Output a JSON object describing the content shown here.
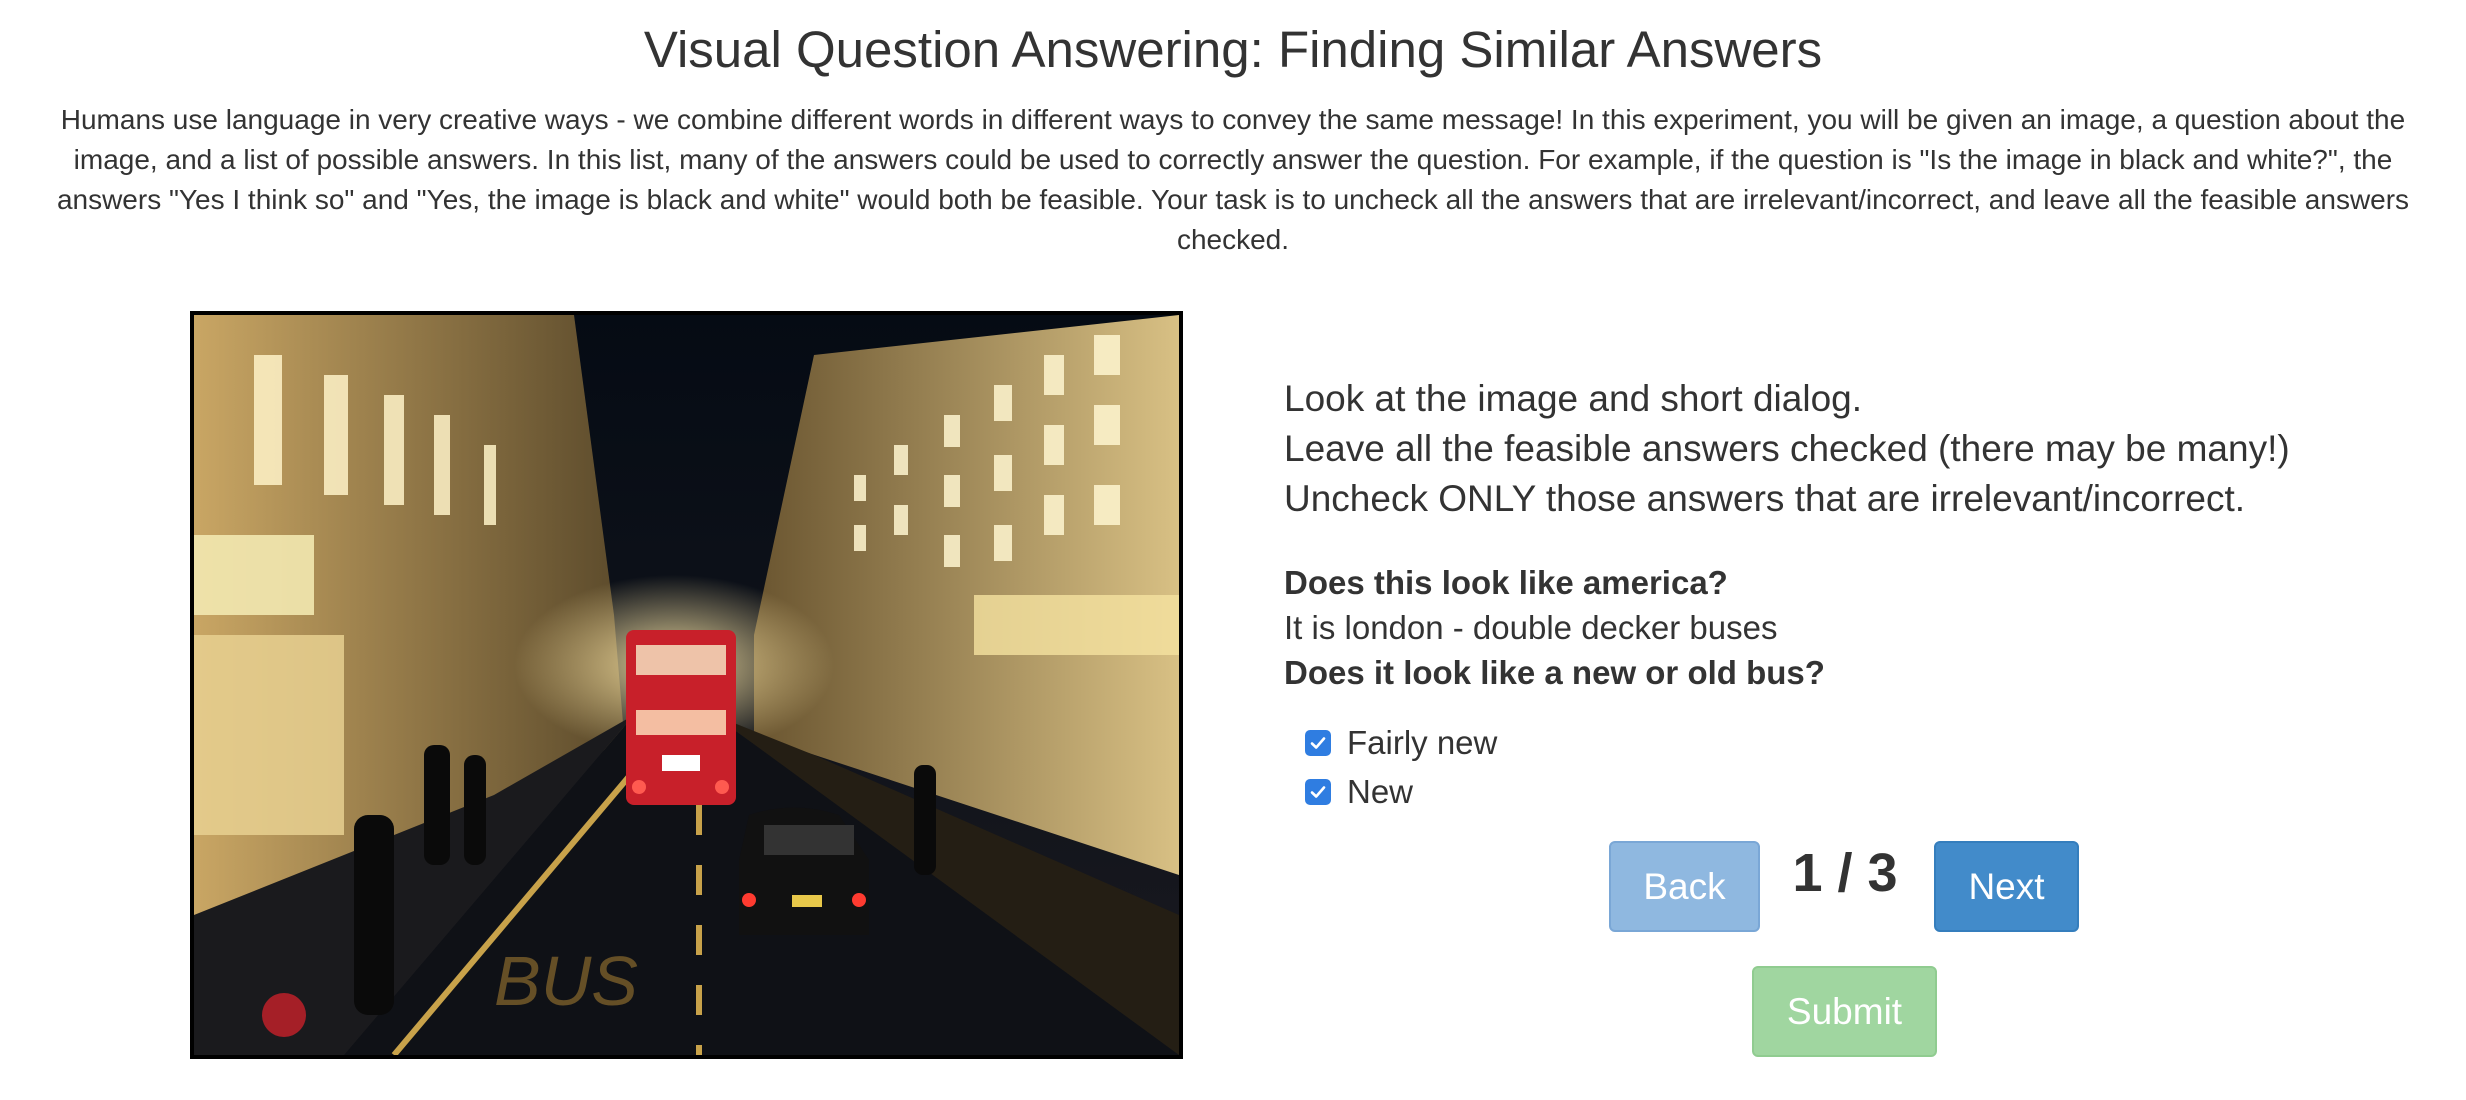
{
  "page": {
    "title": "Visual Question Answering: Finding Similar Answers",
    "intro": "Humans use language in very creative ways - we combine different words in different ways to convey the same message! In this experiment, you will be given an image, a question about the image, and a list of possible answers. In this list, many of the answers could be used to correctly answer the question. For example, if the question is \"Is the image in black and white?\", the answers \"Yes I think so\" and \"Yes, the image is black and white\" would both be feasible. Your task is to uncheck all the answers that are irrelevant/incorrect, and leave all the feasible answers checked."
  },
  "image": {
    "road_text": "BUS"
  },
  "instructions": [
    "Look at the image and short dialog.",
    "Leave all the feasible answers checked (there may be many!)",
    "Uncheck ONLY those answers that are irrelevant/incorrect."
  ],
  "dialog": {
    "question1": "Does this look like america?",
    "answer1": "It is london - double decker buses",
    "question2": "Does it look like a new or old bus?"
  },
  "answers": [
    {
      "label": "Fairly new",
      "checked": true
    },
    {
      "label": "New",
      "checked": true
    }
  ],
  "navigation": {
    "back_label": "Back",
    "next_label": "Next",
    "page_indicator": "1 / 3",
    "submit_label": "Submit"
  },
  "colors": {
    "checkbox": "#2f7de1",
    "back_button": "#8fb8e0",
    "next_button": "#428bca",
    "submit_button": "#a0d6a0"
  }
}
